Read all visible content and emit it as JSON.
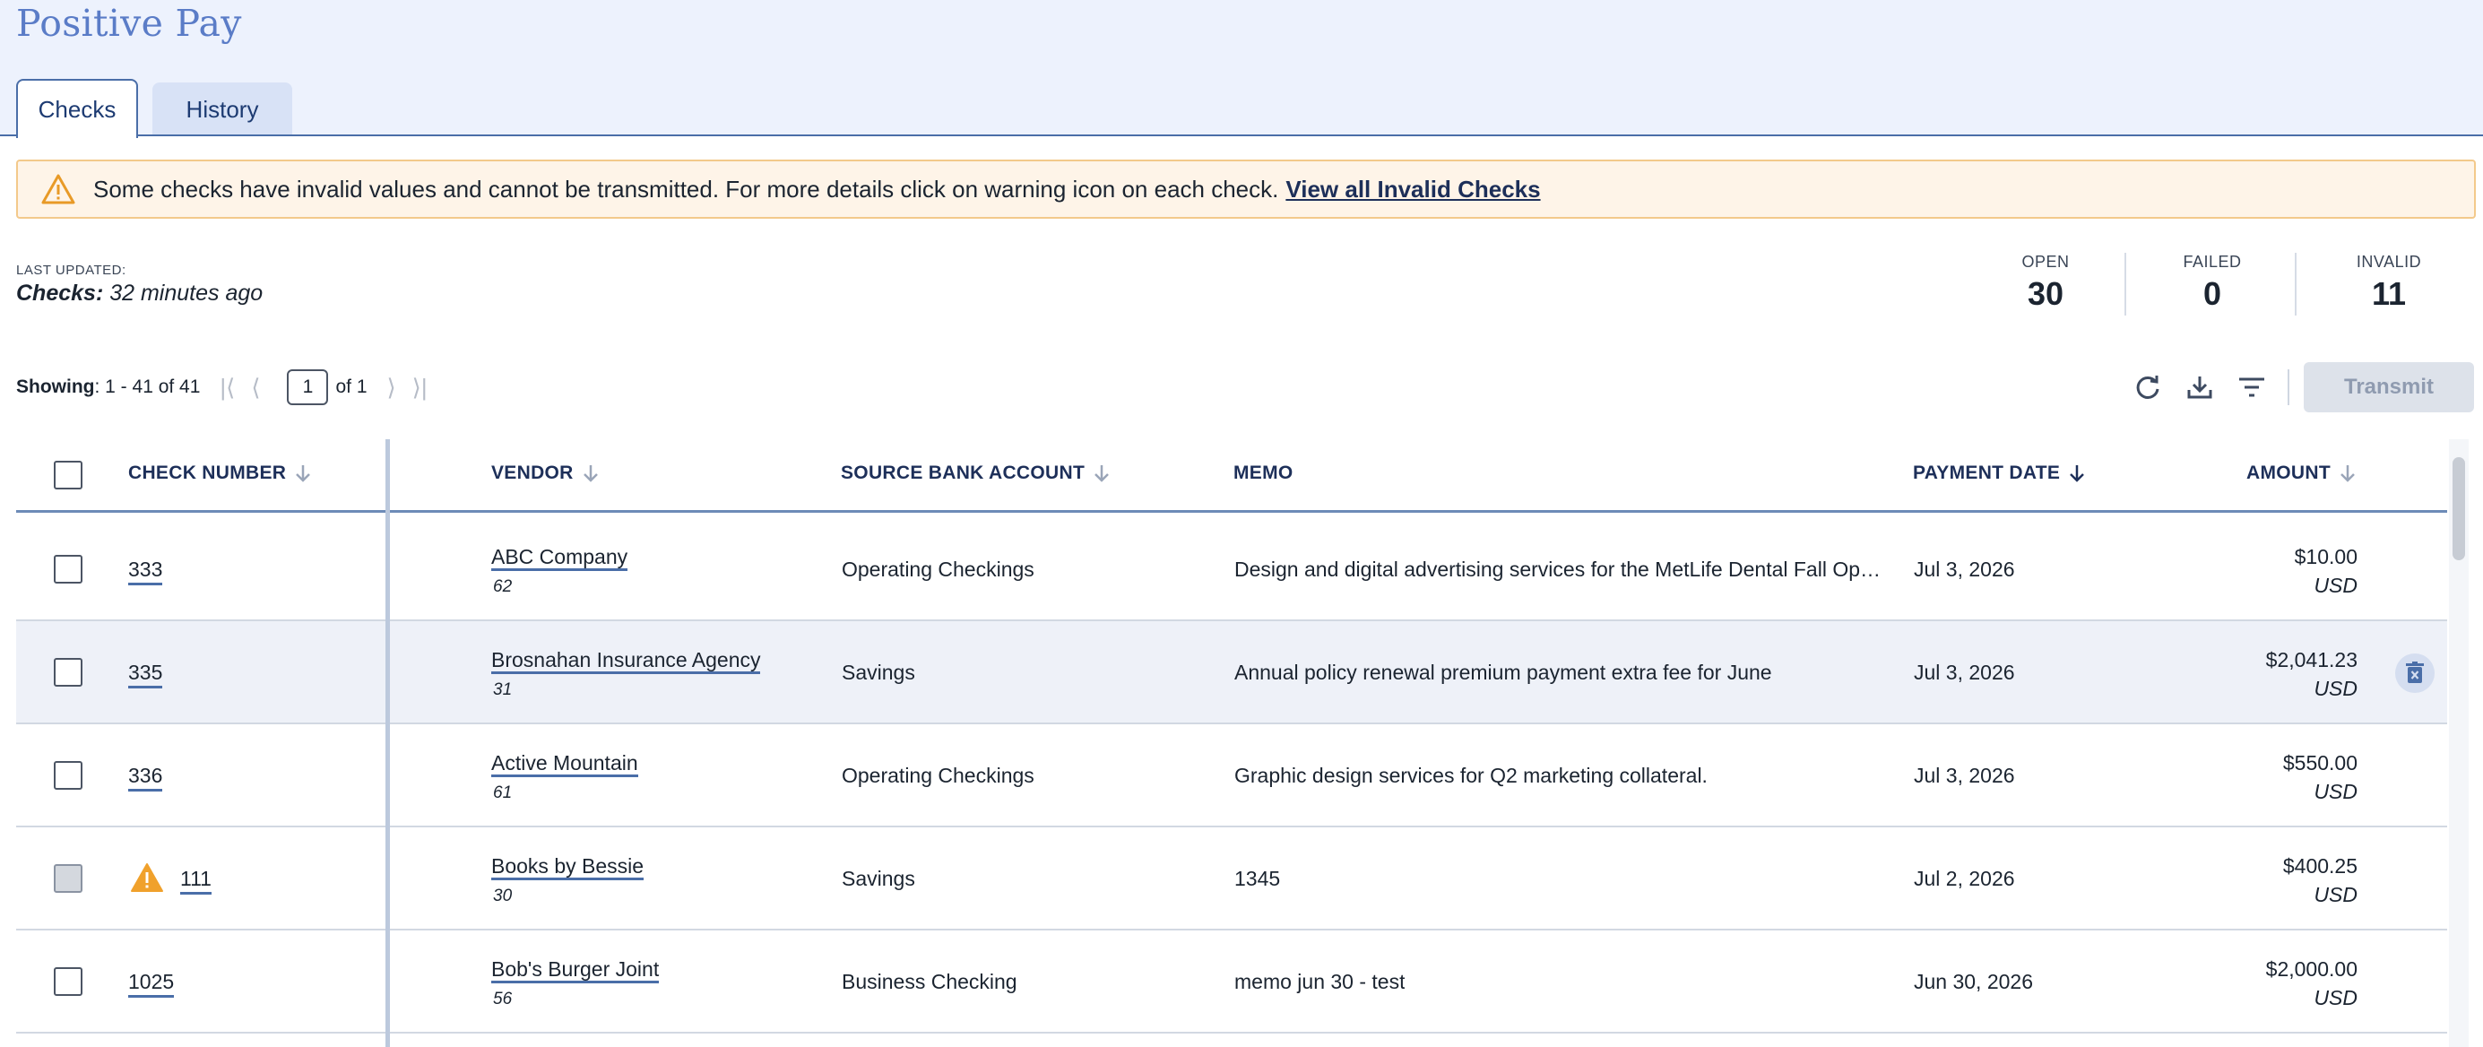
{
  "page": {
    "title": "Positive Pay"
  },
  "tabs": [
    {
      "label": "Checks",
      "active": true
    },
    {
      "label": "History",
      "active": false
    }
  ],
  "alert": {
    "icon": "warning-triangle-icon",
    "message": "Some checks have invalid values and cannot be transmitted. For more details click on warning icon on each check.",
    "link": "View all Invalid Checks",
    "colors": {
      "background": "#fef4e8",
      "border": "#f3c98b",
      "icon": "#e89a27"
    }
  },
  "last_updated": {
    "label": "LAST UPDATED:",
    "prefix": "Checks:",
    "value": "32 minutes ago"
  },
  "stats": {
    "open": {
      "label": "OPEN",
      "value": "30"
    },
    "failed": {
      "label": "FAILED",
      "value": "0"
    },
    "invalid": {
      "label": "INVALID",
      "value": "11"
    }
  },
  "pager": {
    "showing_label": "Showing",
    "showing_value": ": 1 - 41 of 41",
    "page": "1",
    "of_text": "of 1"
  },
  "toolbar": {
    "refresh_icon": "refresh-icon",
    "download_icon": "download-icon",
    "filter_icon": "filter-icon",
    "transmit_label": "Transmit"
  },
  "table": {
    "columns": {
      "check_number": "CHECK NUMBER",
      "vendor": "VENDOR",
      "source_account": "SOURCE BANK ACCOUNT",
      "memo": "MEMO",
      "payment_date": "PAYMENT DATE",
      "amount": "AMOUNT"
    },
    "rows": [
      {
        "check_number": "333",
        "vendor": "ABC Company",
        "vendor_id": "62",
        "account": "Operating Checkings",
        "memo": "Design and digital advertising services for the MetLife Dental Fall Open E...",
        "date": "Jul 3, 2026",
        "amount": "$10.00",
        "currency": "USD",
        "warning": false
      },
      {
        "check_number": "335",
        "vendor": "Brosnahan Insurance Agency",
        "vendor_id": "31",
        "account": "Savings",
        "memo": "Annual policy renewal premium payment extra fee for June",
        "date": "Jul 3, 2026",
        "amount": "$2,041.23",
        "currency": "USD",
        "warning": false
      },
      {
        "check_number": "336",
        "vendor": "Active Mountain",
        "vendor_id": "61",
        "account": "Operating Checkings",
        "memo": "Graphic design services for Q2 marketing collateral.",
        "date": "Jul 3, 2026",
        "amount": "$550.00",
        "currency": "USD",
        "warning": false
      },
      {
        "check_number": "111",
        "vendor": "Books by Bessie",
        "vendor_id": "30",
        "account": "Savings",
        "memo": "1345",
        "date": "Jul 2, 2026",
        "amount": "$400.25",
        "currency": "USD",
        "warning": true
      },
      {
        "check_number": "1025",
        "vendor": "Bob's Burger Joint",
        "vendor_id": "56",
        "account": "Business Checking",
        "memo": "memo jun 30 - test",
        "date": "Jun 30, 2026",
        "amount": "$2,000.00",
        "currency": "USD",
        "warning": false
      }
    ]
  },
  "colors": {
    "accent": "#4a6ea8",
    "title": "#5a7cc7",
    "header_band": "#edf2fd",
    "warning": "#e89a27"
  }
}
